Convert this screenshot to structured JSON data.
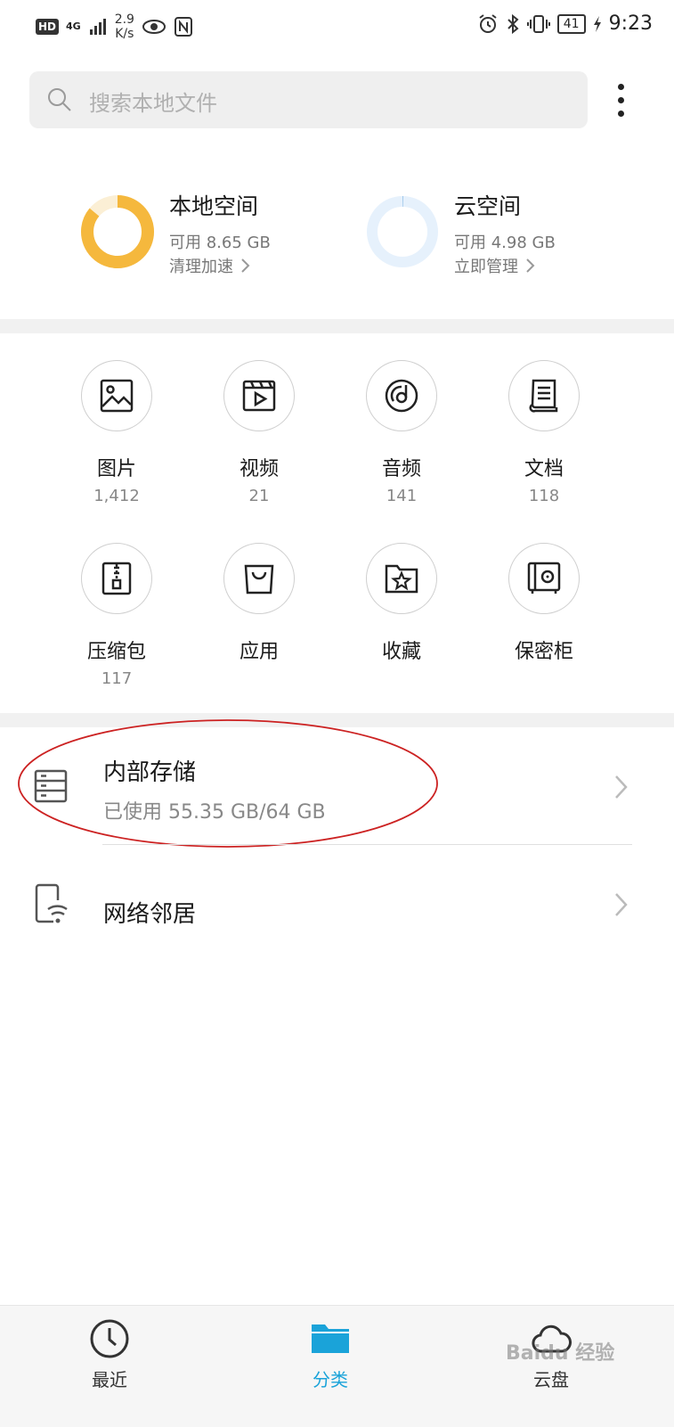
{
  "status_bar": {
    "hd": "HD",
    "network": "4G",
    "speed_value": "2.9",
    "speed_unit": "K/s",
    "battery": "41",
    "time": "9:23"
  },
  "search": {
    "placeholder": "搜索本地文件"
  },
  "local_space": {
    "title": "本地空间",
    "available": "可用 8.65 GB",
    "action": "清理加速",
    "used_fraction": 0.86,
    "color": "#F5B83D"
  },
  "cloud_space": {
    "title": "云空间",
    "available": "可用 4.98 GB",
    "action": "立即管理",
    "used_fraction": 0.004,
    "color": "#E6F1FC"
  },
  "categories": [
    {
      "label": "图片",
      "count": "1,412",
      "icon": "image-icon"
    },
    {
      "label": "视频",
      "count": "21",
      "icon": "video-icon"
    },
    {
      "label": "音频",
      "count": "141",
      "icon": "audio-icon"
    },
    {
      "label": "文档",
      "count": "118",
      "icon": "document-icon"
    },
    {
      "label": "压缩包",
      "count": "117",
      "icon": "archive-icon"
    },
    {
      "label": "应用",
      "count": "",
      "icon": "app-bag-icon"
    },
    {
      "label": "收藏",
      "count": "",
      "icon": "favorite-folder-icon"
    },
    {
      "label": "保密柜",
      "count": "",
      "icon": "safe-icon"
    }
  ],
  "internal_storage": {
    "title": "内部存储",
    "usage": "已使用 55.35 GB/64 GB"
  },
  "network_neighbors": {
    "title": "网络邻居"
  },
  "bottom_nav": [
    {
      "label": "最近",
      "icon": "clock-icon",
      "active": false
    },
    {
      "label": "分类",
      "icon": "folder-icon",
      "active": true
    },
    {
      "label": "云盘",
      "icon": "cloud-icon",
      "active": false
    }
  ],
  "watermark": "Baidu 经验",
  "colors": {
    "accent": "#1AA3D9",
    "annotation": "#CC2222",
    "inactive": "#333333"
  }
}
